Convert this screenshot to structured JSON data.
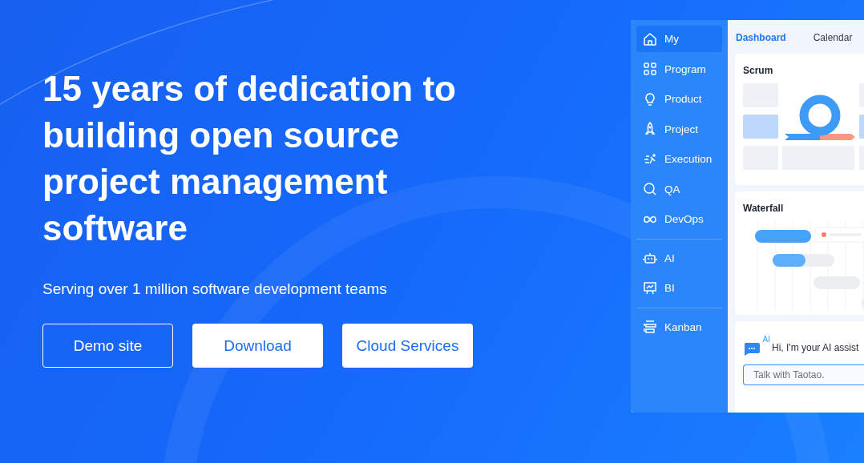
{
  "hero": {
    "title": "15 years of dedication to building open source project management software",
    "subtitle": "Serving over 1 million software development teams",
    "buttons": [
      {
        "label": "Demo site",
        "kind": "outline"
      },
      {
        "label": "Download",
        "kind": "solid"
      },
      {
        "label": "Cloud Services",
        "kind": "solid"
      }
    ]
  },
  "preview": {
    "sidebar": {
      "groups": [
        [
          {
            "label": "My",
            "selected": true
          },
          {
            "label": "Program",
            "selected": false
          },
          {
            "label": "Product",
            "selected": false
          },
          {
            "label": "Project",
            "selected": false
          },
          {
            "label": "Execution",
            "selected": false
          },
          {
            "label": "QA",
            "selected": false
          },
          {
            "label": "DevOps",
            "selected": false
          }
        ],
        [
          {
            "label": "AI",
            "selected": false
          },
          {
            "label": "BI",
            "selected": false
          }
        ],
        [
          {
            "label": "Kanban",
            "selected": false
          }
        ]
      ]
    },
    "tabs": [
      {
        "label": "Dashboard",
        "selected": true
      },
      {
        "label": "Calendar",
        "selected": false
      }
    ],
    "cards": [
      {
        "title": "Scrum",
        "kind": "scrum"
      },
      {
        "title": "Waterfall",
        "kind": "gantt"
      }
    ],
    "assistant": {
      "badge": "AI",
      "greeting": "Hi, I'm your AI assist",
      "placeholder": "Talk with Taotao."
    }
  }
}
